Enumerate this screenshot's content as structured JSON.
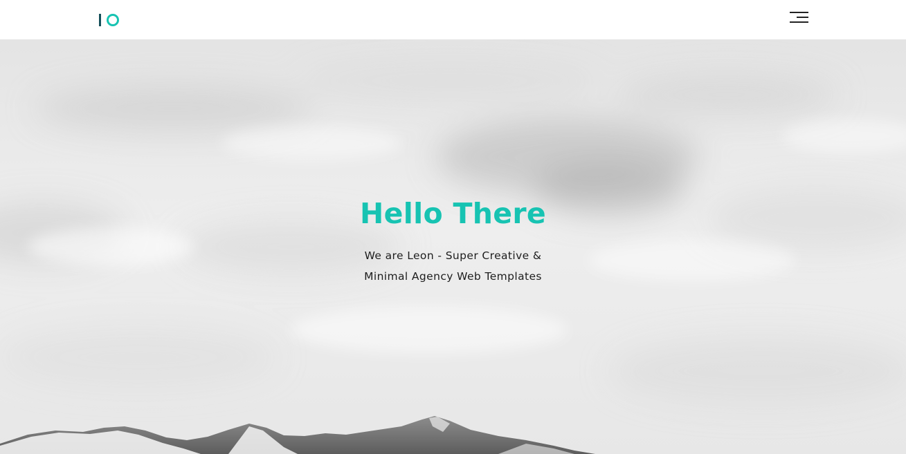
{
  "theme": {
    "accent": "#17c3b2",
    "logo_dark": "#16505a"
  },
  "header": {
    "logo": {
      "name": "logo-mark",
      "shape": "I O monogram"
    },
    "menu": {
      "icon": "hamburger-menu-icon"
    }
  },
  "hero": {
    "title": "Hello There",
    "subtitle_line1": "We are Leon - Super Creative &",
    "subtitle_line2": "Minimal Agency Web Templates",
    "background": "grayscale cloudy sky with snowy mountain ridge"
  }
}
